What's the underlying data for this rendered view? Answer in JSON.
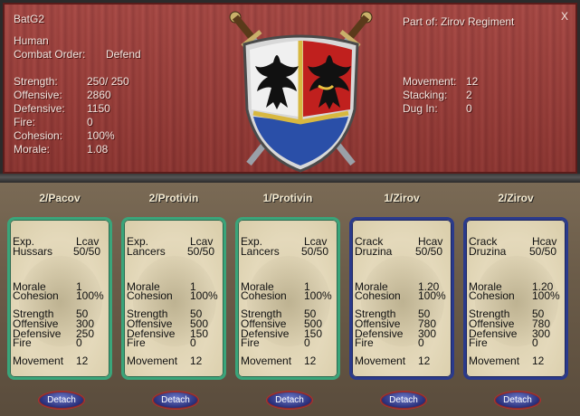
{
  "header": {
    "unit_name": "BatG2",
    "race": "Human",
    "combat_order_label": "Combat Order:",
    "combat_order_value": "Defend",
    "part_of": "Part of: Zirov Regiment",
    "close_label": "X",
    "stats_left": [
      {
        "label": "Strength:",
        "value": "250/ 250"
      },
      {
        "label": "Offensive:",
        "value": "2860"
      },
      {
        "label": "Defensive:",
        "value": "1150"
      },
      {
        "label": "Fire:",
        "value": "0"
      },
      {
        "label": "Cohesion:",
        "value": "100%"
      },
      {
        "label": "Morale:",
        "value": "1.08"
      }
    ],
    "stats_right": [
      {
        "label": "Movement:",
        "value": "12"
      },
      {
        "label": "Stacking:",
        "value": "2"
      },
      {
        "label": "Dug In:",
        "value": "0"
      }
    ]
  },
  "colors": {
    "panel_red": "#9a3a36",
    "green_border": "#3aa57a",
    "blue_border": "#2a3a8c",
    "shield_red": "#c0201e",
    "shield_blue": "#2a4fa8"
  },
  "units": [
    {
      "title": "2/Pacov",
      "exp": "Exp.",
      "type_short": "Lcav",
      "kind": "Hussars",
      "men": "50/50",
      "morale": "1",
      "cohesion": "100%",
      "strength": "50",
      "offensive": "300",
      "defensive": "250",
      "fire": "0",
      "movement": "12",
      "detach_label": "Detach",
      "border": "green"
    },
    {
      "title": "2/Protivin",
      "exp": "Exp.",
      "type_short": "Lcav",
      "kind": "Lancers",
      "men": "50/50",
      "morale": "1",
      "cohesion": "100%",
      "strength": "50",
      "offensive": "500",
      "defensive": "150",
      "fire": "0",
      "movement": "12",
      "detach_label": "Detach",
      "border": "green"
    },
    {
      "title": "1/Protivin",
      "exp": "Exp.",
      "type_short": "Lcav",
      "kind": "Lancers",
      "men": "50/50",
      "morale": "1",
      "cohesion": "100%",
      "strength": "50",
      "offensive": "500",
      "defensive": "150",
      "fire": "0",
      "movement": "12",
      "detach_label": "Detach",
      "border": "green"
    },
    {
      "title": "1/Zirov",
      "exp": "Crack",
      "type_short": "Hcav",
      "kind": "Druzina",
      "men": "50/50",
      "morale": "1.20",
      "cohesion": "100%",
      "strength": "50",
      "offensive": "780",
      "defensive": "300",
      "fire": "0",
      "movement": "12",
      "detach_label": "Detach",
      "border": "blue"
    },
    {
      "title": "2/Zirov",
      "exp": "Crack",
      "type_short": "Hcav",
      "kind": "Druzina",
      "men": "50/50",
      "morale": "1.20",
      "cohesion": "100%",
      "strength": "50",
      "offensive": "780",
      "defensive": "300",
      "fire": "0",
      "movement": "12",
      "detach_label": "Detach",
      "border": "blue"
    }
  ],
  "card_labels": {
    "morale": "Morale",
    "cohesion": "Cohesion",
    "strength": "Strength",
    "offensive": "Offensive",
    "defensive": "Defensive",
    "fire": "Fire",
    "movement": "Movement"
  }
}
